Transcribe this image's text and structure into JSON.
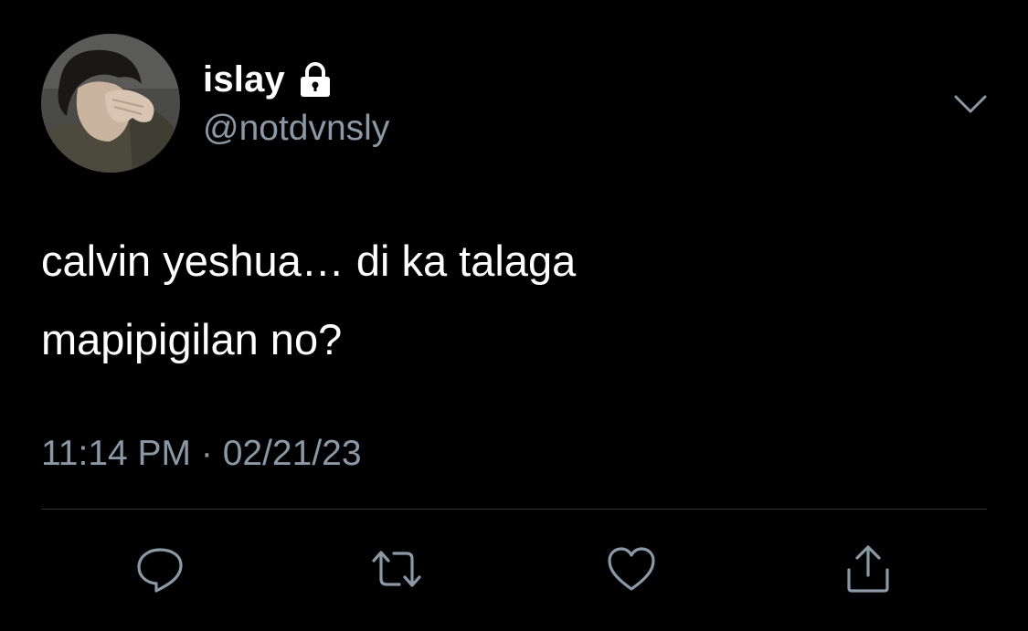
{
  "author": {
    "display_name": "islay",
    "handle": "@notdvnsly",
    "protected": true,
    "avatar": "avatar-photo"
  },
  "tweet": {
    "lines": [
      "calvin yeshua… di ka talaga",
      "mapipigilan no?"
    ],
    "time": "11:14 PM",
    "separator": "·",
    "date": "02/21/23"
  },
  "icons": {
    "lock": "lock-icon",
    "more": "chevron-down-icon",
    "reply": "reply-icon",
    "retweet": "retweet-icon",
    "like": "heart-icon",
    "share": "share-icon"
  },
  "colors": {
    "background": "#000000",
    "text": "#ffffff",
    "secondary": "#8b98a5",
    "divider": "#2f3336"
  }
}
